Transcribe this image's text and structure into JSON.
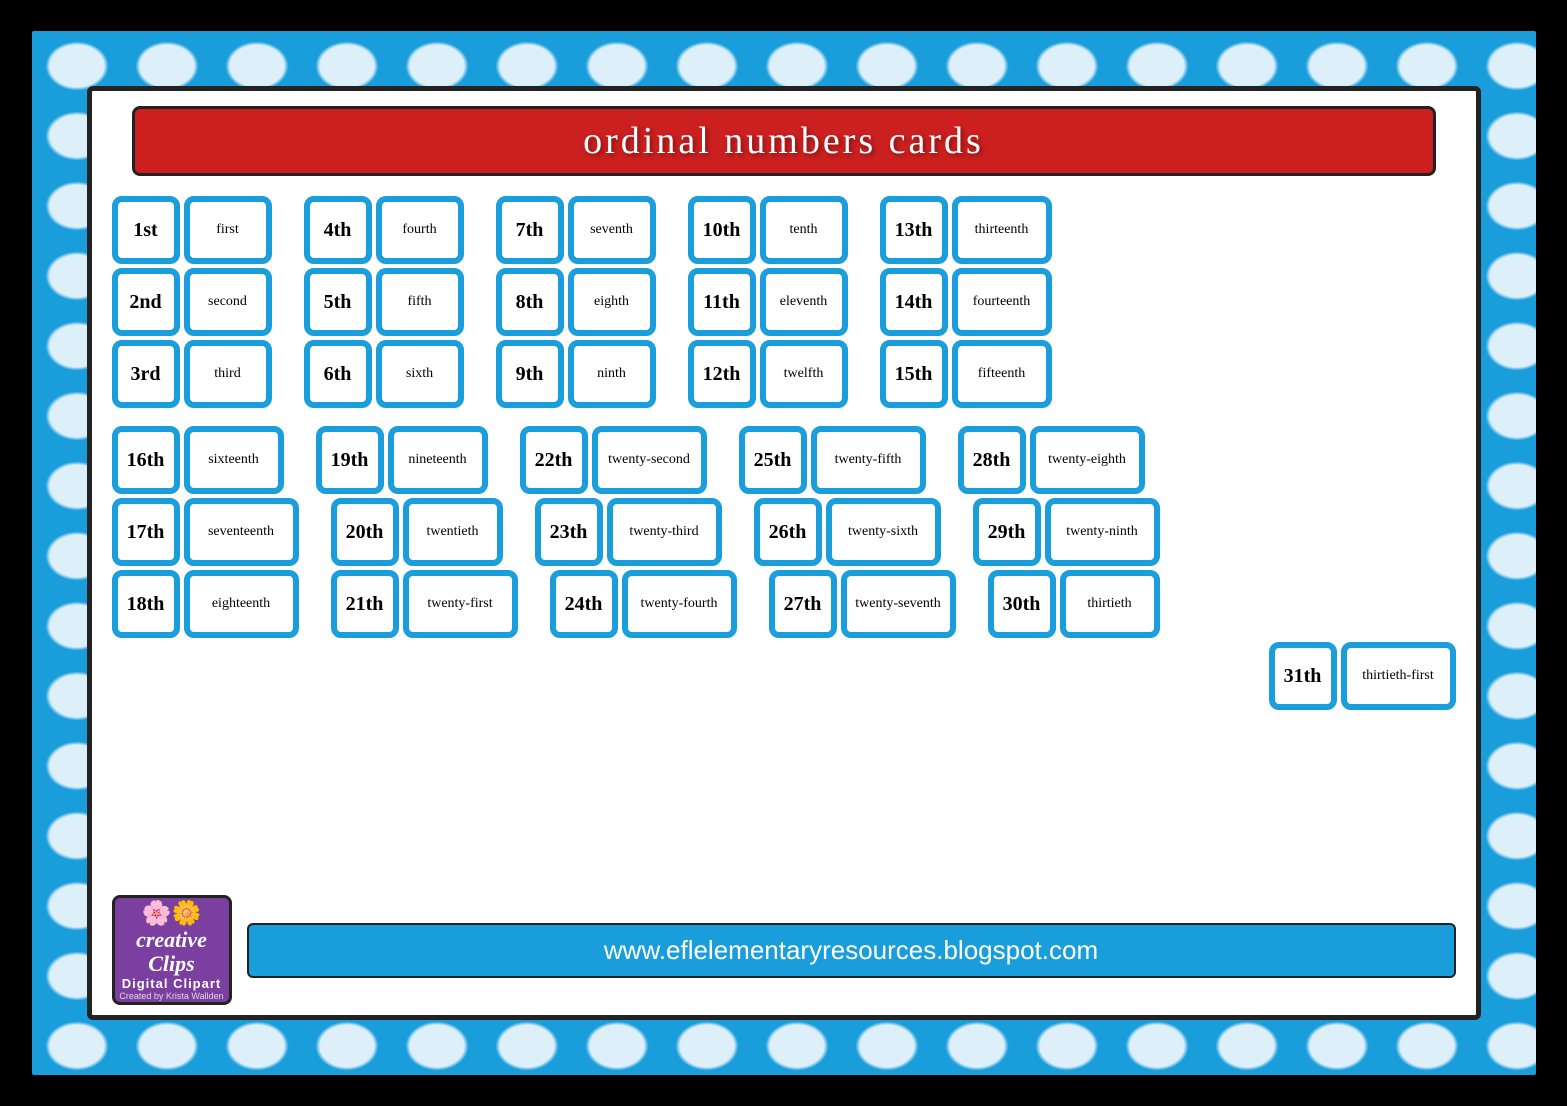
{
  "title": "ordinal numbers cards",
  "website": "www.eflelementaryresources.blogspot.com",
  "logo": {
    "flowers": "🌸🌼",
    "main": "creative\nClips",
    "sub": "Digital Clipart",
    "credit": "Created by Krista Wallden"
  },
  "cards": [
    {
      "num": "1st",
      "word": "first"
    },
    {
      "num": "2nd",
      "word": "second"
    },
    {
      "num": "3rd",
      "word": "third"
    },
    {
      "num": "4th",
      "word": "fourth"
    },
    {
      "num": "5th",
      "word": "fifth"
    },
    {
      "num": "6th",
      "word": "sixth"
    },
    {
      "num": "7th",
      "word": "seventh"
    },
    {
      "num": "8th",
      "word": "eighth"
    },
    {
      "num": "9th",
      "word": "ninth"
    },
    {
      "num": "10th",
      "word": "tenth"
    },
    {
      "num": "11th",
      "word": "eleventh"
    },
    {
      "num": "12th",
      "word": "twelfth"
    },
    {
      "num": "13th",
      "word": "thirteenth"
    },
    {
      "num": "14th",
      "word": "fourteenth"
    },
    {
      "num": "15th",
      "word": "fifteenth"
    },
    {
      "num": "16th",
      "word": "sixteenth"
    },
    {
      "num": "17th",
      "word": "seventeenth"
    },
    {
      "num": "18th",
      "word": "eighteenth"
    },
    {
      "num": "19th",
      "word": "nineteenth"
    },
    {
      "num": "20th",
      "word": "twentieth"
    },
    {
      "num": "21th",
      "word": "twenty-first"
    },
    {
      "num": "22th",
      "word": "twenty-second"
    },
    {
      "num": "23th",
      "word": "twenty-third"
    },
    {
      "num": "24th",
      "word": "twenty-fourth"
    },
    {
      "num": "25th",
      "word": "twenty-fifth"
    },
    {
      "num": "26th",
      "word": "twenty-sixth"
    },
    {
      "num": "27th",
      "word": "twenty-seventh"
    },
    {
      "num": "28th",
      "word": "twenty-eighth"
    },
    {
      "num": "29th",
      "word": "twenty-ninth"
    },
    {
      "num": "30th",
      "word": "thirtieth"
    },
    {
      "num": "31th",
      "word": "thirtieth-first"
    }
  ]
}
